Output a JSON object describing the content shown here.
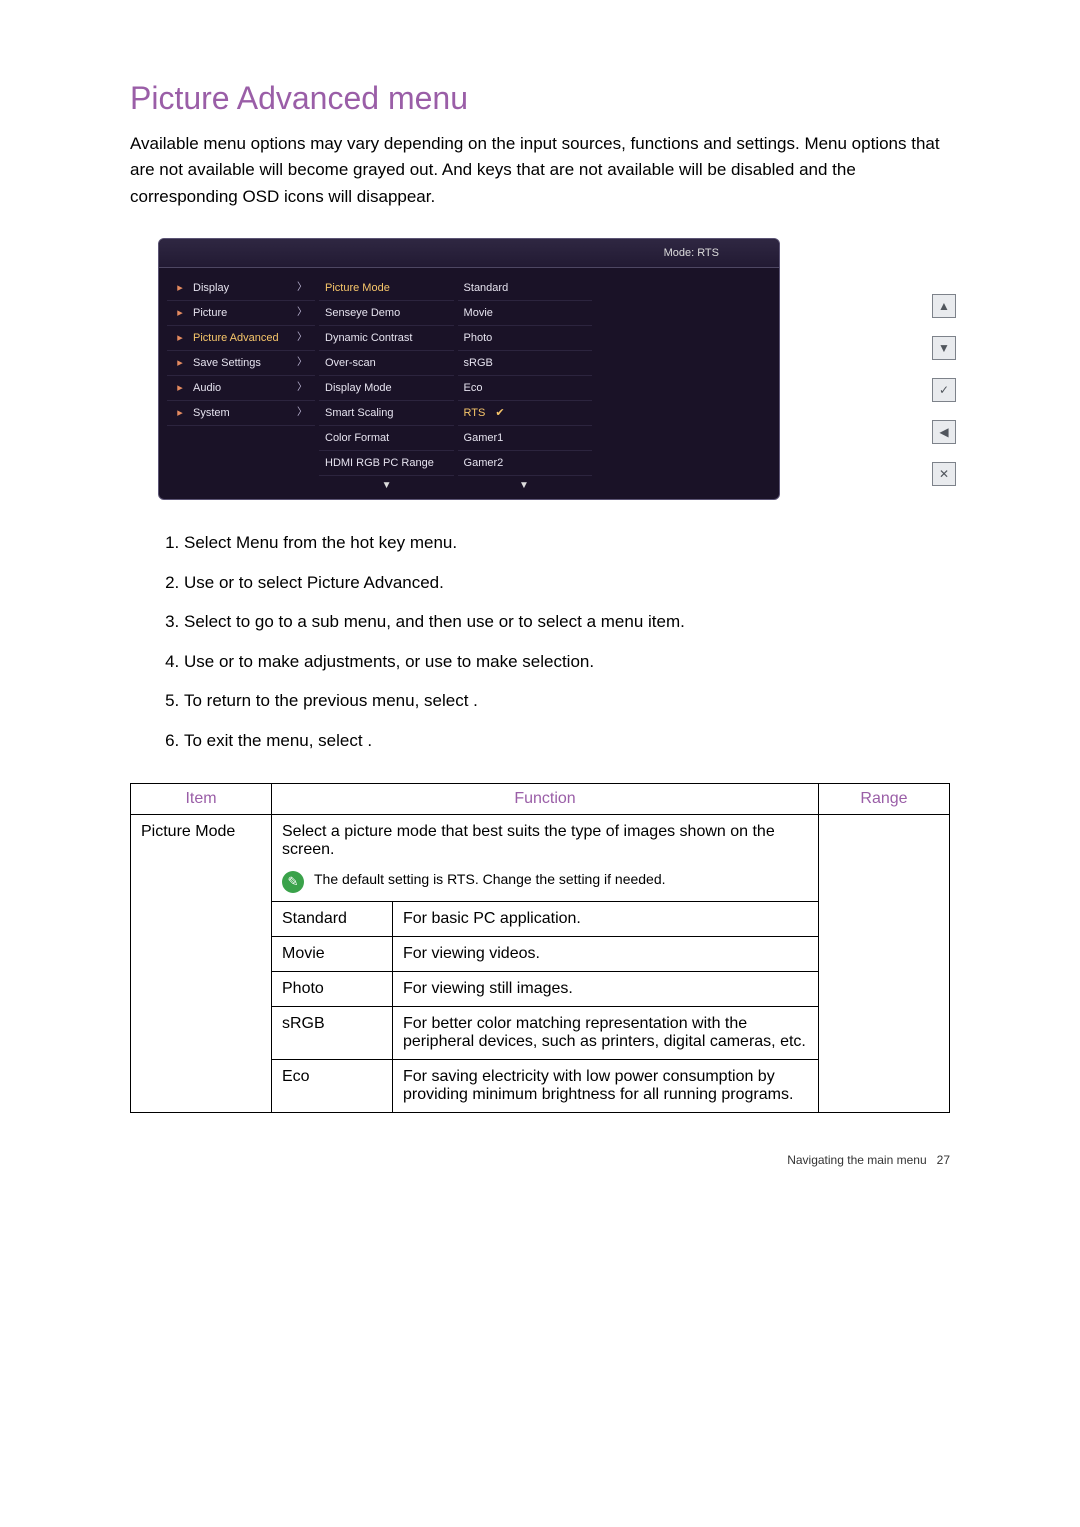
{
  "title": "Picture Advanced menu",
  "intro": "Available menu options may vary depending on the input sources, functions and settings. Menu options that are not available will become grayed out. And keys that are not available will be disabled and the corresponding OSD icons will disappear.",
  "osd": {
    "mode_label": "Mode: RTS",
    "left": [
      {
        "label": "Display"
      },
      {
        "label": "Picture"
      },
      {
        "label": "Picture Advanced",
        "selected": true
      },
      {
        "label": "Save Settings"
      },
      {
        "label": "Audio"
      },
      {
        "label": "System"
      }
    ],
    "mid": [
      {
        "label": "Picture Mode",
        "selected": true
      },
      {
        "label": "Senseye Demo"
      },
      {
        "label": "Dynamic Contrast"
      },
      {
        "label": "Over-scan"
      },
      {
        "label": "Display Mode"
      },
      {
        "label": "Smart Scaling"
      },
      {
        "label": "Color Format"
      },
      {
        "label": "HDMI RGB PC Range"
      }
    ],
    "right": [
      {
        "label": "Standard"
      },
      {
        "label": "Movie"
      },
      {
        "label": "Photo"
      },
      {
        "label": "sRGB"
      },
      {
        "label": "Eco"
      },
      {
        "label": "RTS",
        "selected": true,
        "checked": true
      },
      {
        "label": "Gamer1"
      },
      {
        "label": "Gamer2"
      }
    ],
    "side_buttons": [
      "▲",
      "▼",
      "✓",
      "◀",
      "✕"
    ]
  },
  "steps": [
    "Select Menu from the hot key menu.",
    "Use    or    to select Picture Advanced.",
    "Select    to go to a sub menu, and then use    or    to select a menu item.",
    "Use    or    to make adjustments, or use    to make selection.",
    "To return to the previous menu, select    .",
    "To exit the menu, select    ."
  ],
  "table": {
    "headers": {
      "item": "Item",
      "function": "Function",
      "range": "Range"
    },
    "item_name": "Picture Mode",
    "item_desc": "Select a picture mode that best suits the type of images shown on the screen.",
    "tip": "The default setting is RTS. Change the setting if needed.",
    "rows": [
      {
        "name": "Standard",
        "desc": "For basic PC application."
      },
      {
        "name": "Movie",
        "desc": "For viewing videos."
      },
      {
        "name": "Photo",
        "desc": "For viewing still images."
      },
      {
        "name": "sRGB",
        "desc": "For better color matching representation with the peripheral devices, such as printers, digital cameras, etc."
      },
      {
        "name": "Eco",
        "desc": "For saving electricity with low power consumption by providing minimum brightness for all running programs."
      }
    ]
  },
  "footer": {
    "text": "Navigating the main menu",
    "page": "27"
  }
}
